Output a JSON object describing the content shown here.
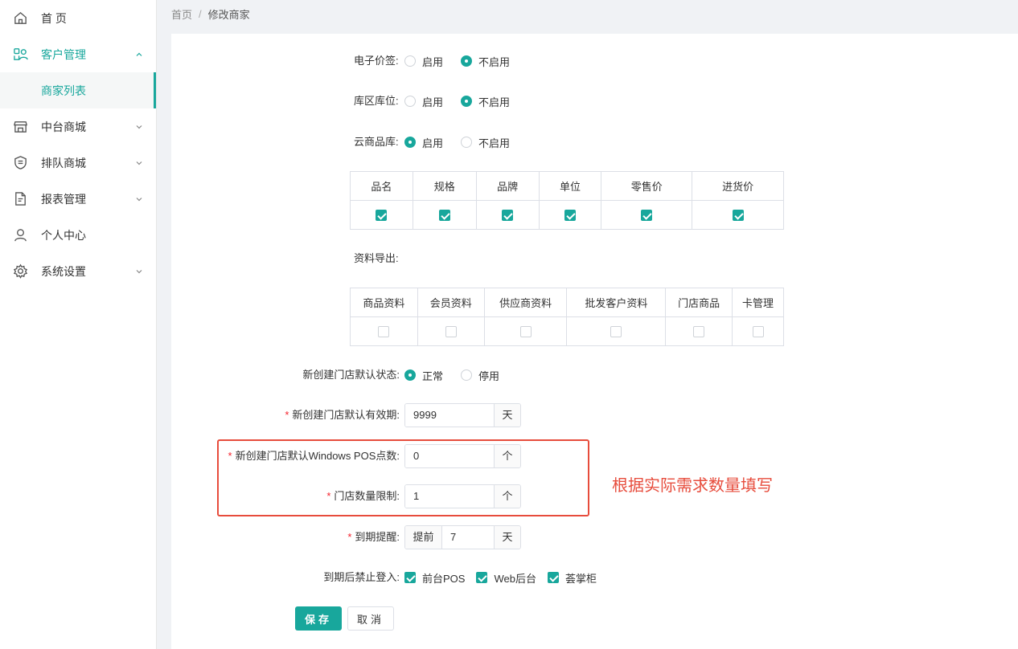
{
  "sidebar": {
    "items": [
      {
        "label": "首 页",
        "icon": "home-icon"
      },
      {
        "label": "客户管理",
        "icon": "customer-icon",
        "sub": [
          {
            "label": "商家列表"
          }
        ]
      },
      {
        "label": "中台商城",
        "icon": "store-icon"
      },
      {
        "label": "排队商城",
        "icon": "shield-icon"
      },
      {
        "label": "报表管理",
        "icon": "report-icon"
      },
      {
        "label": "个人中心",
        "icon": "user-icon"
      },
      {
        "label": "系统设置",
        "icon": "gear-icon"
      }
    ]
  },
  "breadcrumb": {
    "home": "首页",
    "separator": "/",
    "current": "修改商家"
  },
  "form": {
    "esl": {
      "label": "电子价签:",
      "opt_on": "启用",
      "opt_off": "不启用",
      "selected": "不启用"
    },
    "warehouse": {
      "label": "库区库位:",
      "opt_on": "启用",
      "opt_off": "不启用",
      "selected": "不启用"
    },
    "cloud": {
      "label": "云商品库:",
      "opt_on": "启用",
      "opt_off": "不启用",
      "selected": "启用"
    },
    "cloud_fields": {
      "headers": [
        "品名",
        "规格",
        "品牌",
        "单位",
        "零售价",
        "进货价"
      ],
      "checked": [
        true,
        true,
        true,
        true,
        true,
        true
      ]
    },
    "export": {
      "label": "资料导出:",
      "headers": [
        "商品资料",
        "会员资料",
        "供应商资料",
        "批发客户资料",
        "门店商品",
        "卡管理"
      ],
      "checked": [
        false,
        false,
        false,
        false,
        false,
        false
      ]
    },
    "store_status": {
      "label": "新创建门店默认状态:",
      "opt_normal": "正常",
      "opt_stop": "停用",
      "selected": "正常"
    },
    "validity": {
      "required": "*",
      "label": "新创建门店默认有效期:",
      "value": "9999",
      "unit": "天"
    },
    "pos_points": {
      "required": "*",
      "label": "新创建门店默认Windows POS点数:",
      "value": "0",
      "unit": "个"
    },
    "store_limit": {
      "required": "*",
      "label": "门店数量限制:",
      "value": "1",
      "unit": "个"
    },
    "expiry_remind": {
      "required": "*",
      "label": "到期提醒:",
      "prefix": "提前",
      "value": "7",
      "unit": "天"
    },
    "expiry_ban": {
      "label": "到期后禁止登入:",
      "options": [
        {
          "label": "前台POS",
          "checked": true
        },
        {
          "label": "Web后台",
          "checked": true
        },
        {
          "label": "荟掌柜",
          "checked": true
        }
      ]
    }
  },
  "annotation": {
    "note": "根据实际需求数量填写",
    "color": "#e74c3c"
  },
  "buttons": {
    "save": "保存",
    "cancel": "取消"
  },
  "colors": {
    "accent": "#18a79c",
    "required": "#f5222d"
  }
}
